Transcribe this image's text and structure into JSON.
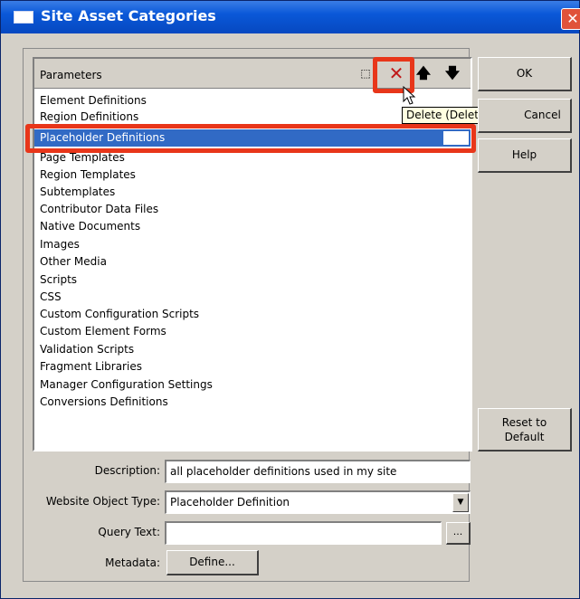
{
  "window": {
    "title": "Site Asset Categories",
    "close_glyph": "✕"
  },
  "list": {
    "header": "Parameters",
    "toolbar": {
      "new_glyph": "⬚",
      "delete_glyph": "✕",
      "up_glyph": "🡅",
      "down_glyph": "🡇"
    },
    "items": [
      {
        "label": "Element Definitions",
        "selected": false
      },
      {
        "label": "Region Definitions",
        "selected": false
      },
      {
        "label": "Placeholder Definitions",
        "selected": true
      },
      {
        "label": "Page Templates",
        "selected": false
      },
      {
        "label": "Region Templates",
        "selected": false
      },
      {
        "label": "Subtemplates",
        "selected": false
      },
      {
        "label": "Contributor Data Files",
        "selected": false
      },
      {
        "label": "Native Documents",
        "selected": false
      },
      {
        "label": "Images",
        "selected": false
      },
      {
        "label": "Other Media",
        "selected": false
      },
      {
        "label": "Scripts",
        "selected": false
      },
      {
        "label": "CSS",
        "selected": false
      },
      {
        "label": "Custom Configuration Scripts",
        "selected": false
      },
      {
        "label": "Custom Element Forms",
        "selected": false
      },
      {
        "label": "Validation Scripts",
        "selected": false
      },
      {
        "label": "Fragment Libraries",
        "selected": false
      },
      {
        "label": "Manager Configuration Settings",
        "selected": false
      },
      {
        "label": "Conversions Definitions",
        "selected": false
      }
    ]
  },
  "tooltip": "Delete (Delete)",
  "buttons": {
    "ok": "OK",
    "cancel": "Cancel",
    "help": "Help",
    "reset_line1": "Reset to",
    "reset_line2": "Default",
    "browse": "...",
    "define": "Define..."
  },
  "form": {
    "description_label": "Description:",
    "description_value": "all placeholder definitions used in my site",
    "type_label": "Website Object Type:",
    "type_value": "Placeholder Definition",
    "query_label": "Query Text:",
    "query_value": "",
    "metadata_label": "Metadata:"
  },
  "colors": {
    "title_bar": "#0a58d8",
    "selection": "#316ac5",
    "highlight_box": "#e8361a",
    "dialog_face": "#d4d0c8",
    "tooltip_bg": "#ffffe1"
  }
}
